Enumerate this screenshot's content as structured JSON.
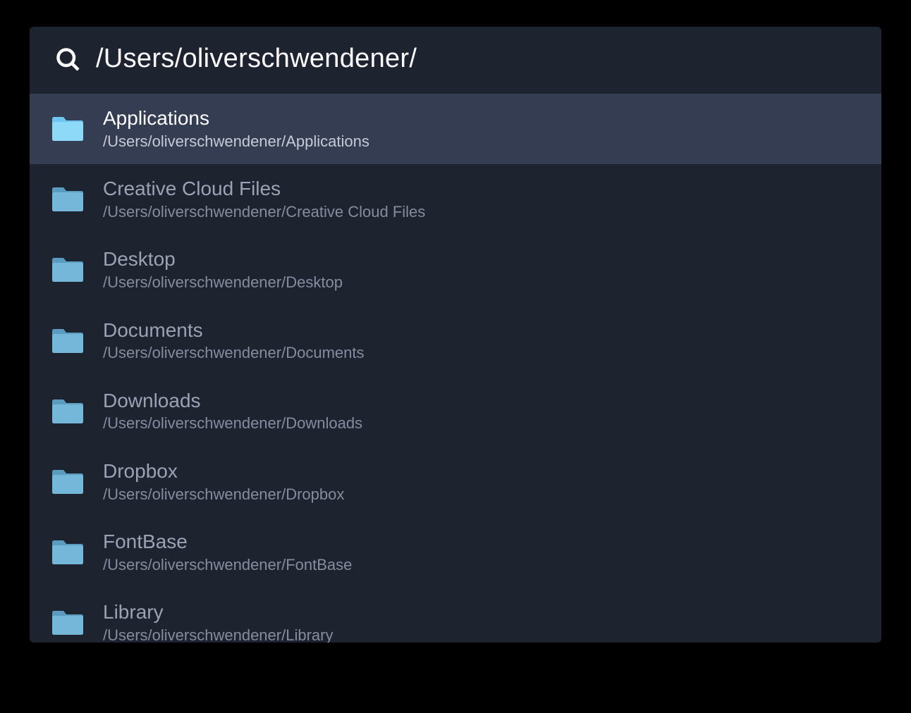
{
  "search": {
    "query": "/Users/oliverschwendener/"
  },
  "selectedIndex": 0,
  "results": [
    {
      "name": "Applications",
      "path": "/Users/oliverschwendener/Applications"
    },
    {
      "name": "Creative Cloud Files",
      "path": "/Users/oliverschwendener/Creative Cloud Files"
    },
    {
      "name": "Desktop",
      "path": "/Users/oliverschwendener/Desktop"
    },
    {
      "name": "Documents",
      "path": "/Users/oliverschwendener/Documents"
    },
    {
      "name": "Downloads",
      "path": "/Users/oliverschwendener/Downloads"
    },
    {
      "name": "Dropbox",
      "path": "/Users/oliverschwendener/Dropbox"
    },
    {
      "name": "FontBase",
      "path": "/Users/oliverschwendener/FontBase"
    },
    {
      "name": "Library",
      "path": "/Users/oliverschwendener/Library"
    }
  ]
}
